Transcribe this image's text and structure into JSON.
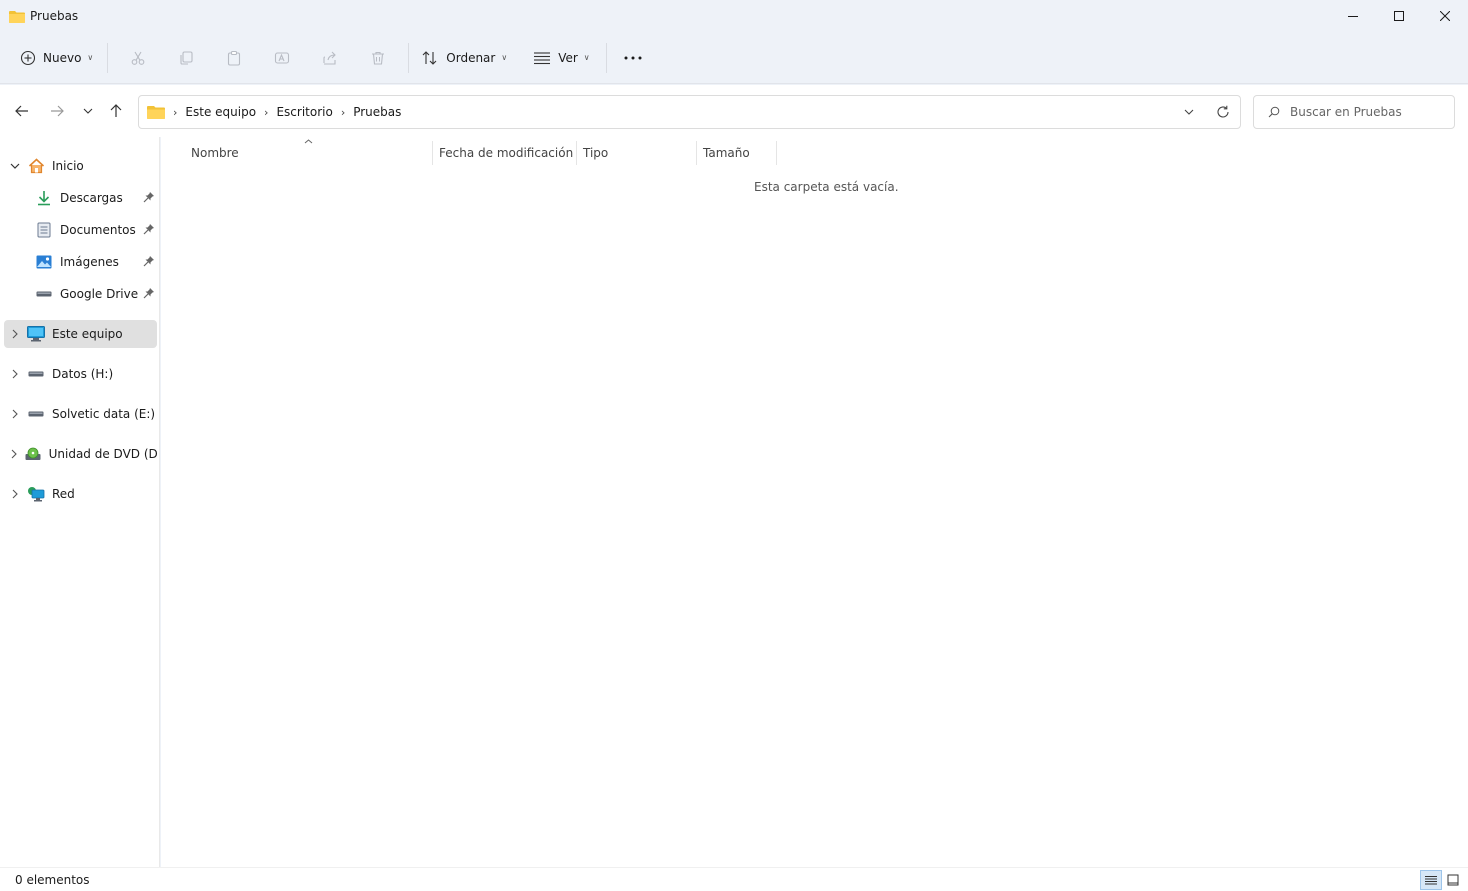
{
  "window": {
    "title": "Pruebas",
    "controls": [
      "minimize",
      "maximize",
      "close"
    ]
  },
  "toolbar": {
    "new_label": "Nuevo",
    "sort_label": "Ordenar",
    "view_label": "Ver",
    "icons": [
      "cut-icon",
      "copy-icon",
      "paste-icon",
      "rename-icon",
      "share-icon",
      "delete-icon",
      "more-options-icon"
    ]
  },
  "address": {
    "crumbs": [
      "Este equipo",
      "Escritorio",
      "Pruebas"
    ]
  },
  "search": {
    "placeholder": "Buscar en Pruebas"
  },
  "sidebar": {
    "home": "Inicio",
    "quick": [
      {
        "label": "Descargas",
        "icon": "download-icon"
      },
      {
        "label": "Documentos",
        "icon": "documents-icon"
      },
      {
        "label": "Imágenes",
        "icon": "pictures-icon"
      },
      {
        "label": "Google Drive (G",
        "icon": "drive-icon"
      }
    ],
    "this_pc": "Este equipo",
    "drives": [
      {
        "label": "Datos (H:)",
        "icon": "drive-icon"
      },
      {
        "label": "Solvetic data (E:)",
        "icon": "drive-icon"
      },
      {
        "label": "Unidad de DVD (D:)",
        "icon": "dvd-icon"
      },
      {
        "label": "Red",
        "icon": "network-icon"
      }
    ]
  },
  "columns": {
    "name": "Nombre",
    "modified": "Fecha de modificación",
    "type": "Tipo",
    "size": "Tamaño"
  },
  "content": {
    "empty_message": "Esta carpeta está vacía."
  },
  "status": {
    "count": "0 elementos"
  },
  "colors": {
    "chrome_bg": "#eef2f8",
    "folder_yellow": "#f2c237",
    "accent_blue": "#1a73c9",
    "selected_bg": "#e0e0e0"
  }
}
